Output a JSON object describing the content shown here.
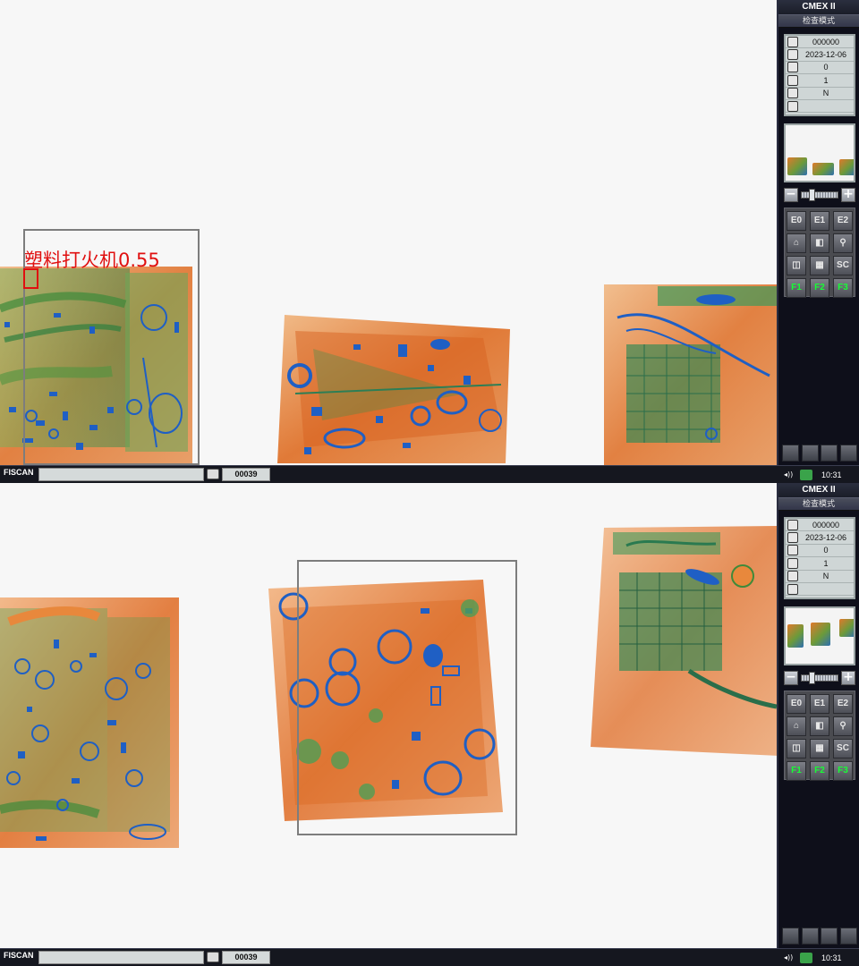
{
  "panel": {
    "brand": "CMEX II",
    "mode": "检查模式",
    "info": [
      {
        "icon": "operator-icon",
        "value": "000000"
      },
      {
        "icon": "calendar-icon",
        "value": "2023-12-06"
      },
      {
        "icon": "counter-icon",
        "value": "0"
      },
      {
        "icon": "magnifier-icon",
        "value": "1"
      },
      {
        "icon": "phone-icon",
        "value": "N"
      },
      {
        "icon": "info-icon",
        "value": ""
      }
    ],
    "keys": [
      "E0",
      "E1",
      "E2",
      "home-icon",
      "contrast-icon",
      "magnify-icon",
      "mirror-icon",
      "keyboard-icon",
      "SC",
      "F1",
      "F2",
      "F3"
    ]
  },
  "taskbar": {
    "brand": "FISCAN",
    "bag_count": "00039",
    "time": "10:31"
  },
  "detection": {
    "label": "塑料打火机0.55",
    "box_color": "#e01010",
    "frame_color": "#7d7d7d"
  },
  "colors": {
    "organic": "#e07a2c",
    "mixed": "#5aa046",
    "metal": "#1f5fc4",
    "scan_bg": "#f7f7f7",
    "panel_bg": "#0e0f1a",
    "key_green": "#17ff35"
  }
}
